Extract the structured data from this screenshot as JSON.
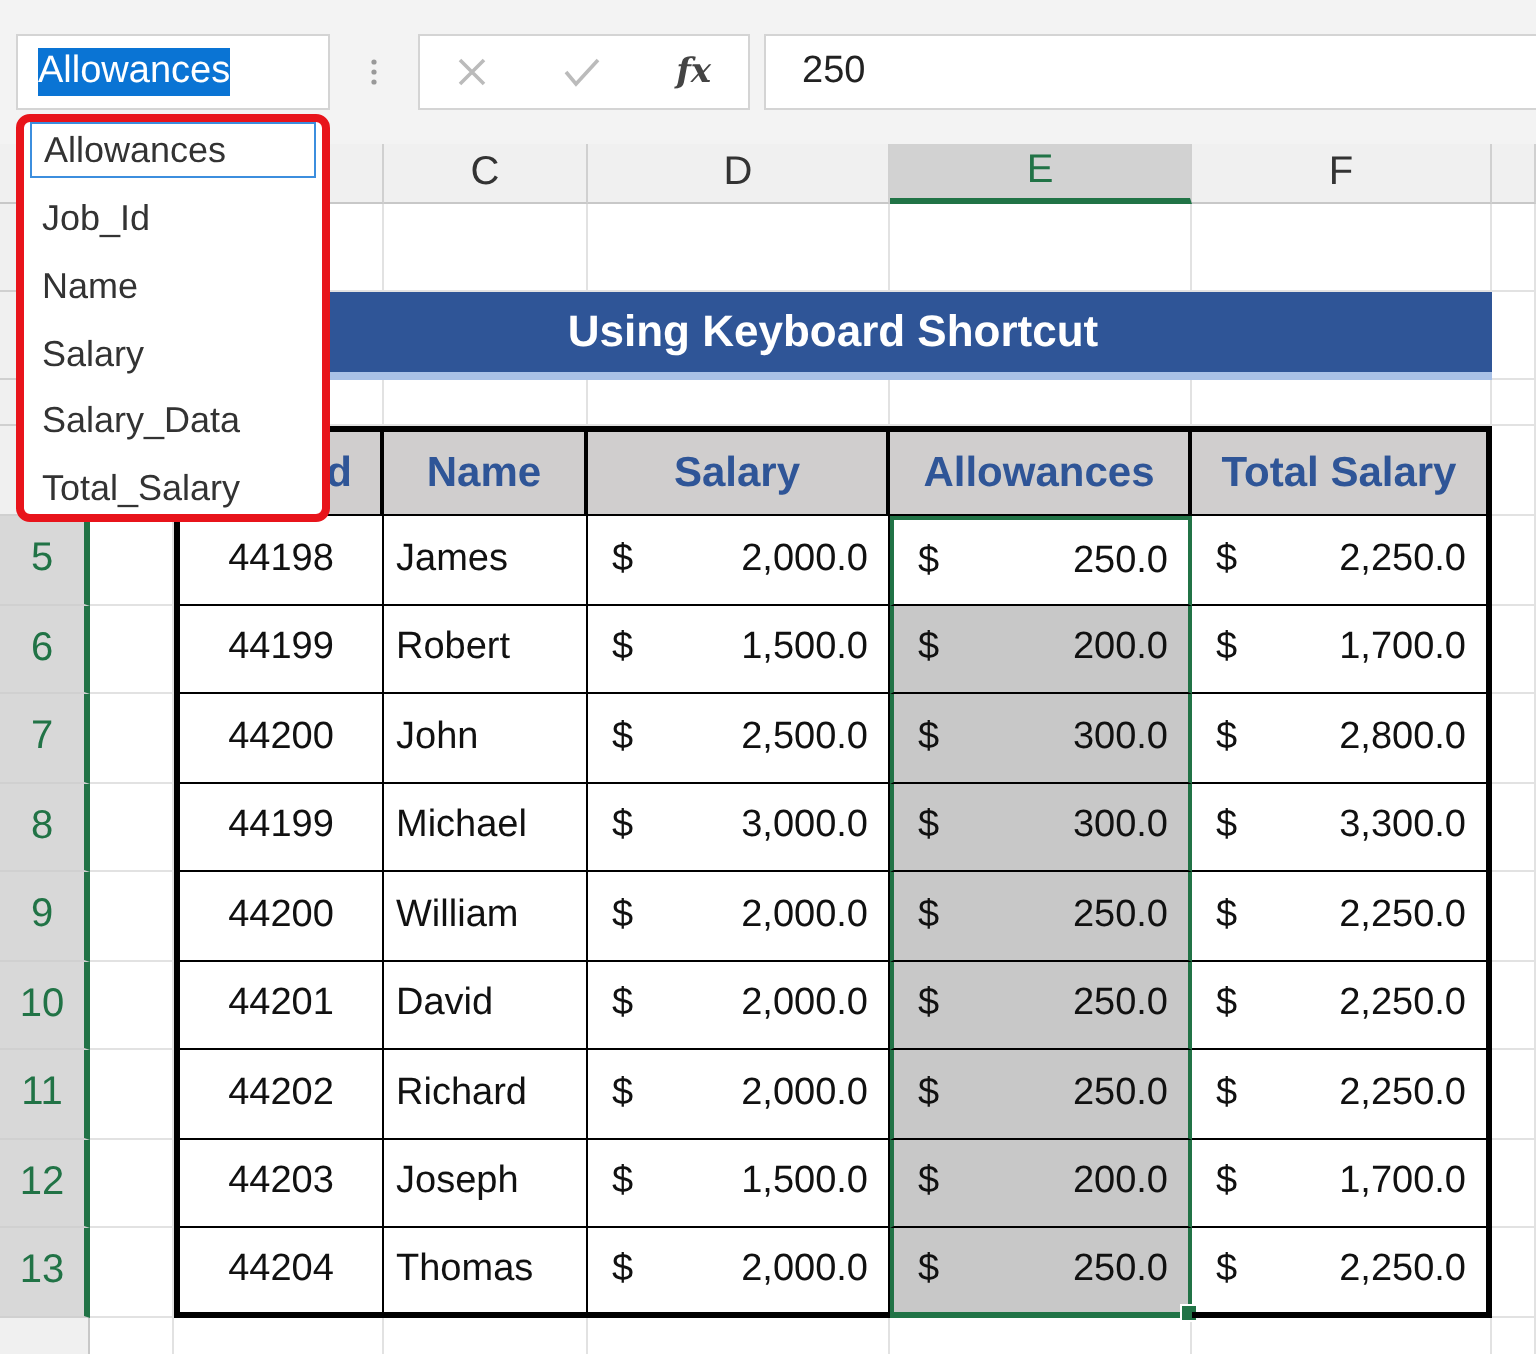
{
  "name_box": {
    "value": "Allowances"
  },
  "name_list": [
    {
      "label": "Allowances",
      "selected": true
    },
    {
      "label": "Job_Id",
      "selected": false
    },
    {
      "label": "Name",
      "selected": false
    },
    {
      "label": "Salary",
      "selected": false
    },
    {
      "label": "Salary_Data",
      "selected": false
    },
    {
      "label": "Total_Salary",
      "selected": false
    }
  ],
  "formula_bar": {
    "function_label": "fx",
    "value": "250"
  },
  "column_headers": [
    {
      "label": "C",
      "selected": false
    },
    {
      "label": "D",
      "selected": false
    },
    {
      "label": "E",
      "selected": true
    },
    {
      "label": "F",
      "selected": false
    }
  ],
  "title": "Using Keyboard Shortcut",
  "table": {
    "columns": [
      "d",
      "Name",
      "Salary",
      "Allowances",
      "Total Salary"
    ],
    "rows": [
      {
        "row_number": "5",
        "job_id": "44198",
        "name": "James",
        "salary_currency": "$",
        "salary": "2,000.0",
        "allowance_currency": "$",
        "allowance": "250.0",
        "allowance_selected": false,
        "total_currency": "$",
        "total": "2,250.0"
      },
      {
        "row_number": "6",
        "job_id": "44199",
        "name": "Robert",
        "salary_currency": "$",
        "salary": "1,500.0",
        "allowance_currency": "$",
        "allowance": "200.0",
        "allowance_selected": true,
        "total_currency": "$",
        "total": "1,700.0"
      },
      {
        "row_number": "7",
        "job_id": "44200",
        "name": "John",
        "salary_currency": "$",
        "salary": "2,500.0",
        "allowance_currency": "$",
        "allowance": "300.0",
        "allowance_selected": true,
        "total_currency": "$",
        "total": "2,800.0"
      },
      {
        "row_number": "8",
        "job_id": "44199",
        "name": "Michael",
        "salary_currency": "$",
        "salary": "3,000.0",
        "allowance_currency": "$",
        "allowance": "300.0",
        "allowance_selected": true,
        "total_currency": "$",
        "total": "3,300.0"
      },
      {
        "row_number": "9",
        "job_id": "44200",
        "name": "William",
        "salary_currency": "$",
        "salary": "2,000.0",
        "allowance_currency": "$",
        "allowance": "250.0",
        "allowance_selected": true,
        "total_currency": "$",
        "total": "2,250.0"
      },
      {
        "row_number": "10",
        "job_id": "44201",
        "name": "David",
        "salary_currency": "$",
        "salary": "2,000.0",
        "allowance_currency": "$",
        "allowance": "250.0",
        "allowance_selected": true,
        "total_currency": "$",
        "total": "2,250.0"
      },
      {
        "row_number": "11",
        "job_id": "44202",
        "name": "Richard",
        "salary_currency": "$",
        "salary": "2,000.0",
        "allowance_currency": "$",
        "allowance": "250.0",
        "allowance_selected": true,
        "total_currency": "$",
        "total": "2,250.0"
      },
      {
        "row_number": "12",
        "job_id": "44203",
        "name": "Joseph",
        "salary_currency": "$",
        "salary": "1,500.0",
        "allowance_currency": "$",
        "allowance": "200.0",
        "allowance_selected": true,
        "total_currency": "$",
        "total": "1,700.0"
      },
      {
        "row_number": "13",
        "job_id": "44204",
        "name": "Thomas",
        "salary_currency": "$",
        "salary": "2,000.0",
        "allowance_currency": "$",
        "allowance": "250.0",
        "allowance_selected": true,
        "total_currency": "$",
        "total": "2,250.0"
      }
    ]
  }
}
